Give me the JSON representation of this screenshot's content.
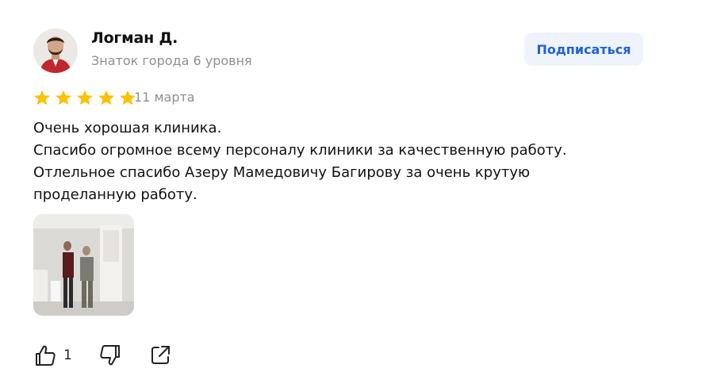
{
  "review": {
    "author": {
      "name": "Логман Д.",
      "level": "Знаток города 6 уровня",
      "avatar_icon": "user-avatar-photo"
    },
    "subscribe_label": "Подписаться",
    "rating": {
      "value": 5,
      "max": 5
    },
    "date": "11 марта",
    "text_lines": [
      "Очень хорошая клиника.",
      "Спасибо огромное всему персоналу клиники за качественную работу.",
      "Отлельное спасибо Азеру Мамедовичу Багирову за очень крутую",
      "проделанную работу."
    ],
    "photos_count": 1,
    "actions": {
      "like_icon": "thumbs-up-icon",
      "like_count": "1",
      "dislike_icon": "thumbs-down-icon",
      "share_icon": "share-icon"
    }
  },
  "colors": {
    "star": "#fcc100",
    "button_bg": "#eef3fc",
    "button_text": "#1f62d8",
    "muted_text": "#8f8f8f"
  }
}
